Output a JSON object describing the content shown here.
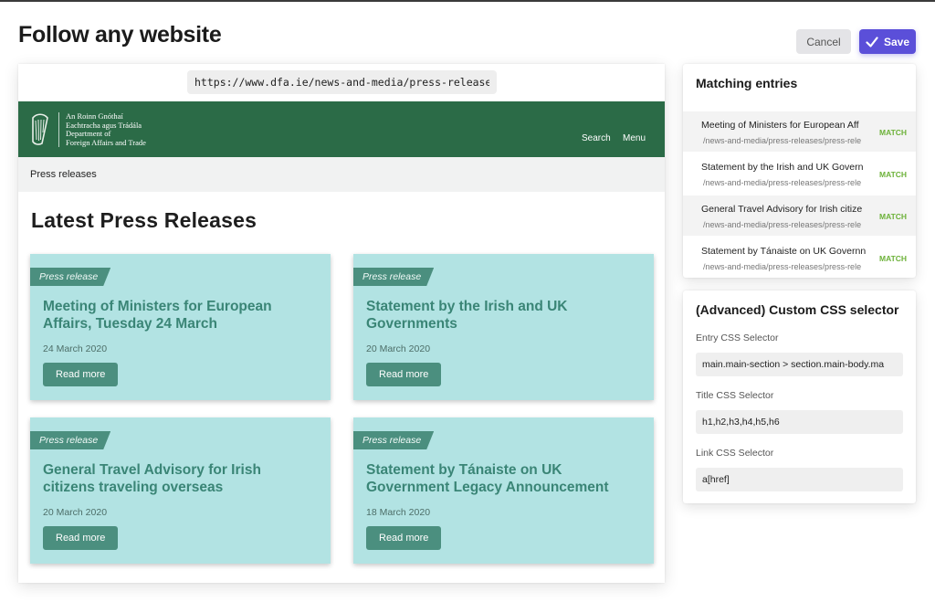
{
  "page": {
    "title": "Follow any website"
  },
  "toolbar": {
    "cancel_label": "Cancel",
    "save_label": "Save",
    "save_icon": "check-icon"
  },
  "preview": {
    "url": "https://www.dfa.ie/news-and-media/press-releases/",
    "site": {
      "dept_line1": "An Roinn Gnóthaí",
      "dept_line2": "Eachtracha agus Trádála",
      "dept_line3": "Department of",
      "dept_line4": "Foreign Affairs and Trade",
      "logo_icon": "harp-icon",
      "nav_search": "Search",
      "nav_menu": "Menu",
      "breadcrumb": "Press releases",
      "heading": "Latest Press Releases"
    },
    "cards": [
      {
        "tag": "Press release",
        "title": "Meeting of Ministers for European Affairs, Tuesday 24 March",
        "date": "24 March 2020",
        "button": "Read more"
      },
      {
        "tag": "Press release",
        "title": "Statement by the Irish and UK Governments",
        "date": "20 March 2020",
        "button": "Read more"
      },
      {
        "tag": "Press release",
        "title": "General Travel Advisory for Irish citizens traveling overseas",
        "date": "20 March 2020",
        "button": "Read more"
      },
      {
        "tag": "Press release",
        "title": "Statement by Tánaiste on UK Government Legacy Announcement",
        "date": "18 March 2020",
        "button": "Read more"
      }
    ]
  },
  "matching": {
    "title": "Matching entries",
    "entries": [
      {
        "title": "Meeting of Ministers for European Aff",
        "path": "/news-and-media/press-releases/press-rele",
        "badge": "MATCH"
      },
      {
        "title": "Statement by the Irish and UK Govern",
        "path": "/news-and-media/press-releases/press-rele",
        "badge": "MATCH"
      },
      {
        "title": "General Travel Advisory for Irish citize",
        "path": "/news-and-media/press-releases/press-rele",
        "badge": "MATCH"
      },
      {
        "title": "Statement by Tánaiste on UK Governn",
        "path": "/news-and-media/press-releases/press-rele",
        "badge": "MATCH"
      }
    ]
  },
  "advanced": {
    "title": "(Advanced) Custom CSS selector",
    "entry_label": "Entry CSS Selector",
    "entry_value": "main.main-section > section.main-body.ma",
    "title_label": "Title CSS Selector",
    "title_value": "h1,h2,h3,h4,h5,h6",
    "link_label": "Link CSS Selector",
    "link_value": "a[href]"
  },
  "colors": {
    "accent": "#5b4fd9",
    "site_green": "#2b6b47",
    "card_bg": "#b2e3e3",
    "card_accent": "#4b8f7f",
    "match_green": "#6db23a"
  }
}
